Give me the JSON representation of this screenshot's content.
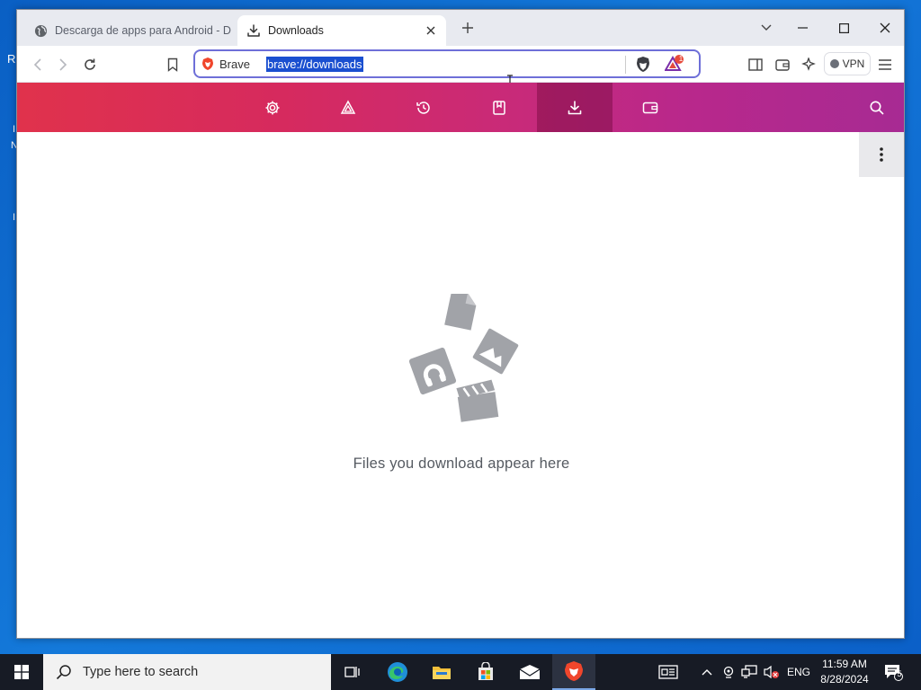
{
  "desktop": {
    "edge_chars": [
      "R",
      "I",
      "N",
      "I"
    ]
  },
  "browser": {
    "tabs": [
      {
        "title": "Descarga de apps para Android - D",
        "active": false
      },
      {
        "title": "Downloads",
        "active": true
      }
    ],
    "omnibox": {
      "brand_label": "Brave",
      "url": "brave://downloads",
      "rewards_badge": "1"
    },
    "vpn_label": "VPN",
    "accent": "#6e6fd8"
  },
  "nav": {
    "items": [
      "settings-icon",
      "brave-rewards-icon",
      "history-icon",
      "bookmarks-icon",
      "downloads-icon",
      "wallet-icon"
    ],
    "selected": "downloads-icon",
    "gradient_start": "#e0324c",
    "gradient_end": "#a72a93"
  },
  "content": {
    "empty_message": "Files you download appear here"
  },
  "taskbar": {
    "search_placeholder": "Type here to search",
    "language": "ENG",
    "time": "11:59 AM",
    "date": "8/28/2024",
    "notification_count": "5"
  }
}
